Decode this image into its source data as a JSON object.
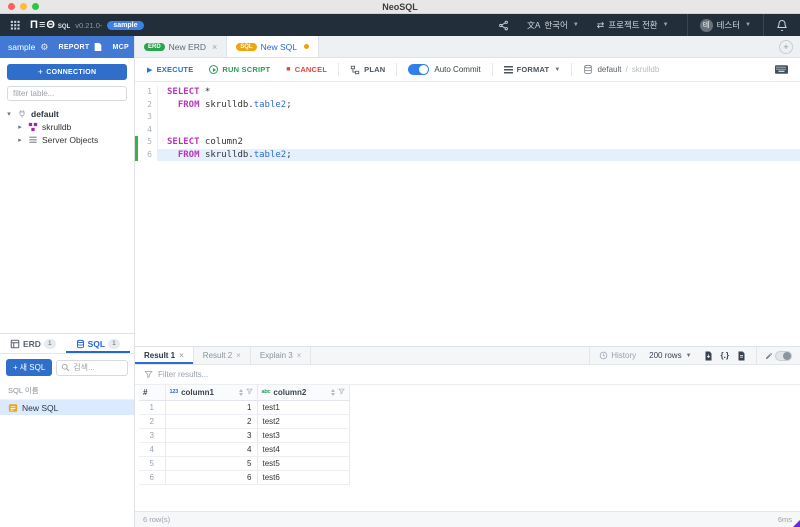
{
  "window": {
    "title": "NeoSQL"
  },
  "header": {
    "logo_sql": "SQL",
    "version": "v0.21.0-",
    "env_badge": "sample",
    "language_label": "한국어",
    "project_switch_label": "프로젝트 전환",
    "user_initial": "테",
    "user_name": "테스터"
  },
  "sidebar": {
    "connection_name": "sample",
    "report_label": "REPORT",
    "mcp_label": "MCP",
    "add_connection_label": "CONNECTION",
    "filter_placeholder": "filter table...",
    "tree": [
      {
        "label": "default",
        "icon": "plug-icon",
        "chevron": "expanded",
        "indent": 0
      },
      {
        "label": "skrulldb",
        "icon": "schema-icon",
        "chevron": "collapsed",
        "indent": 1
      },
      {
        "label": "Server Objects",
        "icon": "list-icon",
        "chevron": "collapsed",
        "indent": 1
      }
    ],
    "panel_tabs": [
      {
        "label": "ERD",
        "count": "1",
        "icon": "erd-icon",
        "active": false
      },
      {
        "label": "SQL",
        "count": "1",
        "icon": "database-icon",
        "active": true
      }
    ],
    "new_sql_label": "새 SQL",
    "search_placeholder": "검색...",
    "list_header": "SQL 이름",
    "sql_list": [
      {
        "label": "New SQL",
        "selected": true
      }
    ]
  },
  "doc_tabs": [
    {
      "badge": "ERD",
      "badge_color": "#2ca44e",
      "label": "New ERD",
      "active": false,
      "dirty": false
    },
    {
      "badge": "SQL",
      "badge_color": "#eda512",
      "label": "New SQL",
      "active": true,
      "dirty": true
    }
  ],
  "toolbar": {
    "execute": "EXECUTE",
    "run_script": "RUN SCRIPT",
    "cancel": "CANCEL",
    "plan": "PLAN",
    "auto_commit": "Auto Commit",
    "format": "FORMAT",
    "db_default": "default",
    "db_separator": "/",
    "db_schema": "skrulldb"
  },
  "editor": {
    "lines": [
      {
        "num": "1",
        "marked": false,
        "highlight": false,
        "segments": [
          {
            "text": "SELECT",
            "cls": "kw"
          },
          {
            "text": " *",
            "cls": "pl"
          }
        ]
      },
      {
        "num": "2",
        "marked": false,
        "highlight": false,
        "segments": [
          {
            "text": "  ",
            "cls": "pl"
          },
          {
            "text": "FROM",
            "cls": "kw"
          },
          {
            "text": " skrulldb.",
            "cls": "pl"
          },
          {
            "text": "table2",
            "cls": "id"
          },
          {
            "text": ";",
            "cls": "pl"
          }
        ]
      },
      {
        "num": "3",
        "marked": false,
        "highlight": false,
        "segments": []
      },
      {
        "num": "4",
        "marked": false,
        "highlight": false,
        "segments": []
      },
      {
        "num": "5",
        "marked": true,
        "highlight": false,
        "segments": [
          {
            "text": "SELECT",
            "cls": "kw"
          },
          {
            "text": " column2",
            "cls": "pl"
          }
        ]
      },
      {
        "num": "6",
        "marked": true,
        "highlight": true,
        "segments": [
          {
            "text": "  ",
            "cls": "pl"
          },
          {
            "text": "FROM",
            "cls": "kw"
          },
          {
            "text": " skrulldb.",
            "cls": "pl"
          },
          {
            "text": "table2",
            "cls": "id"
          },
          {
            "text": ";",
            "cls": "pl"
          }
        ]
      }
    ]
  },
  "results": {
    "tabs": [
      {
        "label": "Result 1",
        "active": true
      },
      {
        "label": "Result 2",
        "active": false
      },
      {
        "label": "Explain 3",
        "active": false
      }
    ],
    "history_label": "History",
    "rows_selector": "200 rows",
    "filter_placeholder": "Filter results...",
    "table": {
      "index_header": "#",
      "columns": [
        {
          "name": "column1",
          "type": "number",
          "type_icon": "123"
        },
        {
          "name": "column2",
          "type": "text",
          "type_icon": "abc"
        }
      ],
      "rows": [
        {
          "index": "1",
          "column1": "1",
          "column2": "test1"
        },
        {
          "index": "2",
          "column1": "2",
          "column2": "test2"
        },
        {
          "index": "3",
          "column1": "3",
          "column2": "test3"
        },
        {
          "index": "4",
          "column1": "4",
          "column2": "test4"
        },
        {
          "index": "5",
          "column1": "5",
          "column2": "test5"
        },
        {
          "index": "6",
          "column1": "6",
          "column2": "test6"
        }
      ]
    },
    "status_left": "6 row(s)",
    "status_right": "6ms"
  },
  "colors": {
    "accent_blue": "#2f6bd8",
    "erd_green": "#2ca44e",
    "sql_yellow": "#eda512",
    "keyword_magenta": "#b737b7",
    "identifier_blue": "#2e6bd6",
    "marker_green": "#3fae49",
    "corner_purple": "#6d28d9"
  }
}
